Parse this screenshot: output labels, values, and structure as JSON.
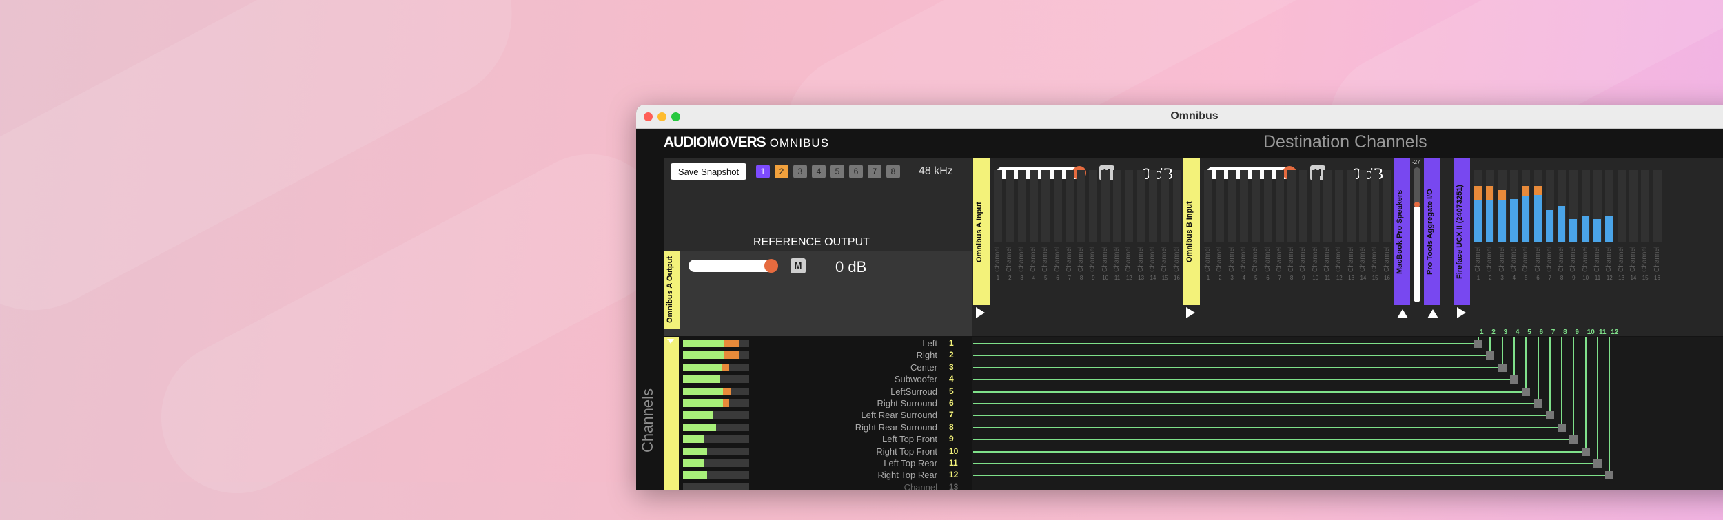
{
  "window": {
    "title": "Omnibus"
  },
  "brand": {
    "name": "AUDIOMOVERS",
    "product": "OMNIBUS"
  },
  "destination_title": "Destination Channels",
  "sidebar_label": "Channels",
  "panel": {
    "snapshot_button": "Save Snapshot",
    "snapshots": [
      "1",
      "2",
      "3",
      "4",
      "5",
      "6",
      "7",
      "8"
    ],
    "sample_rate": "48 kHz",
    "reference_title": "REFERENCE OUTPUT",
    "reference_chip": "Omnibus A Output",
    "reference_db": "0 dB",
    "mute_label": "M"
  },
  "destinations": [
    {
      "name": "Omnibus A Input",
      "db": "0 dB"
    },
    {
      "name": "Omnibus B Input",
      "db": "0 dB"
    },
    {
      "name": "MacBook Pro Speakers"
    },
    {
      "name": "Pro Tools Aggregate I/O",
      "level": "-27"
    },
    {
      "name": "Fireface UCX II (24073251)"
    }
  ],
  "channel_label": "Channel",
  "source": {
    "name": "Omnibus A Output",
    "rows": [
      {
        "name": "Left",
        "num": "1",
        "level": 0.62,
        "peak": 0.22
      },
      {
        "name": "Right",
        "num": "2",
        "level": 0.62,
        "peak": 0.22
      },
      {
        "name": "Center",
        "num": "3",
        "level": 0.58,
        "peak": 0.12
      },
      {
        "name": "Subwoofer",
        "num": "4",
        "level": 0.55,
        "peak": 0
      },
      {
        "name": "LeftSurroud",
        "num": "5",
        "level": 0.6,
        "peak": 0.12
      },
      {
        "name": "Right Surround",
        "num": "6",
        "level": 0.6,
        "peak": 0.1
      },
      {
        "name": "Left Rear Surround",
        "num": "7",
        "level": 0.45,
        "peak": 0
      },
      {
        "name": "Right Rear Surround",
        "num": "8",
        "level": 0.5,
        "peak": 0
      },
      {
        "name": "Left Top Front",
        "num": "9",
        "level": 0.32,
        "peak": 0
      },
      {
        "name": "Right Top Front",
        "num": "10",
        "level": 0.36,
        "peak": 0
      },
      {
        "name": "Left Top Rear",
        "num": "11",
        "level": 0.32,
        "peak": 0
      },
      {
        "name": "Right Top Rear",
        "num": "12",
        "level": 0.36,
        "peak": 0
      },
      {
        "name": "Channel",
        "num": "13",
        "level": 0,
        "peak": 0
      }
    ]
  },
  "fireface_levels": [
    0.78,
    0.78,
    0.72,
    0.6,
    0.78,
    0.78,
    0.45,
    0.5,
    0.32,
    0.36,
    0.32,
    0.36
  ],
  "fireface_peaks": [
    0.2,
    0.2,
    0.14,
    0,
    0.14,
    0.12,
    0,
    0,
    0,
    0,
    0,
    0
  ],
  "routes": [
    "1",
    "2",
    "3",
    "4",
    "5",
    "6",
    "7",
    "8",
    "9",
    "10",
    "11",
    "12"
  ]
}
